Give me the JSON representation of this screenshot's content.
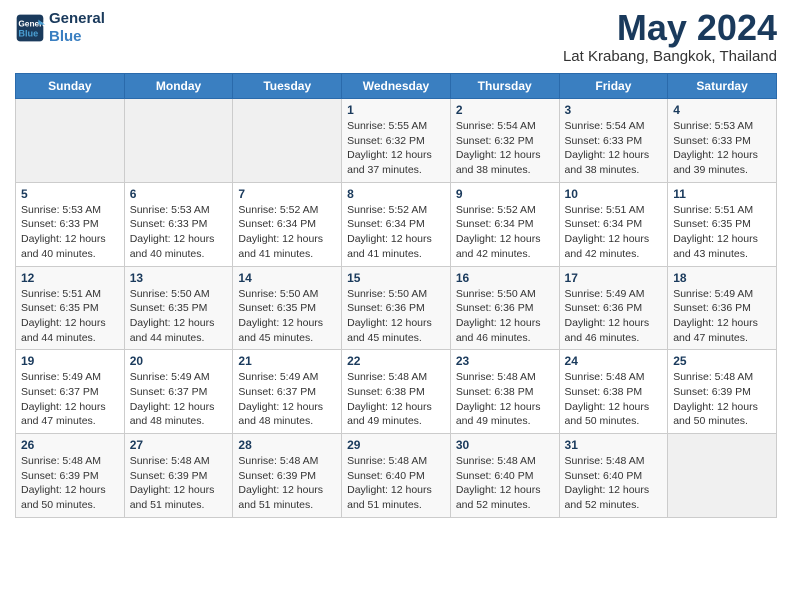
{
  "header": {
    "logo_line1": "General",
    "logo_line2": "Blue",
    "title": "May 2024",
    "subtitle": "Lat Krabang, Bangkok, Thailand"
  },
  "weekdays": [
    "Sunday",
    "Monday",
    "Tuesday",
    "Wednesday",
    "Thursday",
    "Friday",
    "Saturday"
  ],
  "weeks": [
    [
      {
        "day": "",
        "info": ""
      },
      {
        "day": "",
        "info": ""
      },
      {
        "day": "",
        "info": ""
      },
      {
        "day": "1",
        "info": "Sunrise: 5:55 AM\nSunset: 6:32 PM\nDaylight: 12 hours\nand 37 minutes."
      },
      {
        "day": "2",
        "info": "Sunrise: 5:54 AM\nSunset: 6:32 PM\nDaylight: 12 hours\nand 38 minutes."
      },
      {
        "day": "3",
        "info": "Sunrise: 5:54 AM\nSunset: 6:33 PM\nDaylight: 12 hours\nand 38 minutes."
      },
      {
        "day": "4",
        "info": "Sunrise: 5:53 AM\nSunset: 6:33 PM\nDaylight: 12 hours\nand 39 minutes."
      }
    ],
    [
      {
        "day": "5",
        "info": "Sunrise: 5:53 AM\nSunset: 6:33 PM\nDaylight: 12 hours\nand 40 minutes."
      },
      {
        "day": "6",
        "info": "Sunrise: 5:53 AM\nSunset: 6:33 PM\nDaylight: 12 hours\nand 40 minutes."
      },
      {
        "day": "7",
        "info": "Sunrise: 5:52 AM\nSunset: 6:34 PM\nDaylight: 12 hours\nand 41 minutes."
      },
      {
        "day": "8",
        "info": "Sunrise: 5:52 AM\nSunset: 6:34 PM\nDaylight: 12 hours\nand 41 minutes."
      },
      {
        "day": "9",
        "info": "Sunrise: 5:52 AM\nSunset: 6:34 PM\nDaylight: 12 hours\nand 42 minutes."
      },
      {
        "day": "10",
        "info": "Sunrise: 5:51 AM\nSunset: 6:34 PM\nDaylight: 12 hours\nand 42 minutes."
      },
      {
        "day": "11",
        "info": "Sunrise: 5:51 AM\nSunset: 6:35 PM\nDaylight: 12 hours\nand 43 minutes."
      }
    ],
    [
      {
        "day": "12",
        "info": "Sunrise: 5:51 AM\nSunset: 6:35 PM\nDaylight: 12 hours\nand 44 minutes."
      },
      {
        "day": "13",
        "info": "Sunrise: 5:50 AM\nSunset: 6:35 PM\nDaylight: 12 hours\nand 44 minutes."
      },
      {
        "day": "14",
        "info": "Sunrise: 5:50 AM\nSunset: 6:35 PM\nDaylight: 12 hours\nand 45 minutes."
      },
      {
        "day": "15",
        "info": "Sunrise: 5:50 AM\nSunset: 6:36 PM\nDaylight: 12 hours\nand 45 minutes."
      },
      {
        "day": "16",
        "info": "Sunrise: 5:50 AM\nSunset: 6:36 PM\nDaylight: 12 hours\nand 46 minutes."
      },
      {
        "day": "17",
        "info": "Sunrise: 5:49 AM\nSunset: 6:36 PM\nDaylight: 12 hours\nand 46 minutes."
      },
      {
        "day": "18",
        "info": "Sunrise: 5:49 AM\nSunset: 6:36 PM\nDaylight: 12 hours\nand 47 minutes."
      }
    ],
    [
      {
        "day": "19",
        "info": "Sunrise: 5:49 AM\nSunset: 6:37 PM\nDaylight: 12 hours\nand 47 minutes."
      },
      {
        "day": "20",
        "info": "Sunrise: 5:49 AM\nSunset: 6:37 PM\nDaylight: 12 hours\nand 48 minutes."
      },
      {
        "day": "21",
        "info": "Sunrise: 5:49 AM\nSunset: 6:37 PM\nDaylight: 12 hours\nand 48 minutes."
      },
      {
        "day": "22",
        "info": "Sunrise: 5:48 AM\nSunset: 6:38 PM\nDaylight: 12 hours\nand 49 minutes."
      },
      {
        "day": "23",
        "info": "Sunrise: 5:48 AM\nSunset: 6:38 PM\nDaylight: 12 hours\nand 49 minutes."
      },
      {
        "day": "24",
        "info": "Sunrise: 5:48 AM\nSunset: 6:38 PM\nDaylight: 12 hours\nand 50 minutes."
      },
      {
        "day": "25",
        "info": "Sunrise: 5:48 AM\nSunset: 6:39 PM\nDaylight: 12 hours\nand 50 minutes."
      }
    ],
    [
      {
        "day": "26",
        "info": "Sunrise: 5:48 AM\nSunset: 6:39 PM\nDaylight: 12 hours\nand 50 minutes."
      },
      {
        "day": "27",
        "info": "Sunrise: 5:48 AM\nSunset: 6:39 PM\nDaylight: 12 hours\nand 51 minutes."
      },
      {
        "day": "28",
        "info": "Sunrise: 5:48 AM\nSunset: 6:39 PM\nDaylight: 12 hours\nand 51 minutes."
      },
      {
        "day": "29",
        "info": "Sunrise: 5:48 AM\nSunset: 6:40 PM\nDaylight: 12 hours\nand 51 minutes."
      },
      {
        "day": "30",
        "info": "Sunrise: 5:48 AM\nSunset: 6:40 PM\nDaylight: 12 hours\nand 52 minutes."
      },
      {
        "day": "31",
        "info": "Sunrise: 5:48 AM\nSunset: 6:40 PM\nDaylight: 12 hours\nand 52 minutes."
      },
      {
        "day": "",
        "info": ""
      }
    ]
  ]
}
